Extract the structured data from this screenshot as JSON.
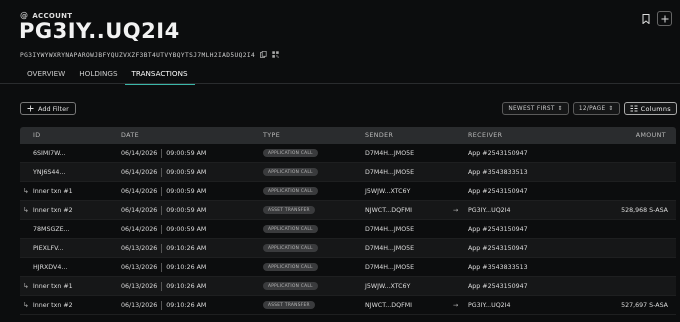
{
  "header": {
    "section_label": "ACCOUNT",
    "title": "PG3IY..UQ2I4",
    "address": "PG3IYWYWXRYNAPAROWJBFYQUZVXZF3BT4UTVYBQYTSJ7MLH2IAD5UQ2I4",
    "actions": [
      "bookmark-icon",
      "plus-icon"
    ]
  },
  "tabs": [
    {
      "label": "OVERVIEW",
      "active": false
    },
    {
      "label": "HOLDINGS",
      "active": false
    },
    {
      "label": "TRANSACTIONS",
      "active": true
    }
  ],
  "toolbar": {
    "add_filter_label": "Add Filter",
    "sort_label": "NEWEST FIRST",
    "page_size_label": "12/PAGE",
    "columns_label": "Columns"
  },
  "table": {
    "headers": {
      "id": "ID",
      "date": "DATE",
      "type": "TYPE",
      "sender": "SENDER",
      "receiver": "RECEIVER",
      "amount": "AMOUNT"
    },
    "rows": [
      {
        "id": "6SIMI7W...",
        "inner": false,
        "date": "06/14/2026",
        "time": "09:00:59 AM",
        "type": "APPLICATION CALL",
        "sender": "D7M4H...JMO5E",
        "arrow": "",
        "receiver": "App #2543150947",
        "amount": ""
      },
      {
        "id": "YNJ6S44...",
        "inner": false,
        "date": "06/14/2026",
        "time": "09:00:59 AM",
        "type": "APPLICATION CALL",
        "sender": "D7M4H...JMO5E",
        "arrow": "",
        "receiver": "App #3543833513",
        "amount": ""
      },
      {
        "id": "Inner txn #1",
        "inner": true,
        "date": "06/14/2026",
        "time": "09:00:59 AM",
        "type": "APPLICATION CALL",
        "sender": "J5WJW...XTC6Y",
        "arrow": "",
        "receiver": "App #2543150947",
        "amount": ""
      },
      {
        "id": "Inner txn #2",
        "inner": true,
        "date": "06/14/2026",
        "time": "09:00:59 AM",
        "type": "ASSET TRANSFER",
        "sender": "NJWCT...DQFMI",
        "arrow": "→",
        "receiver": "PG3IY...UQ2I4",
        "amount": "528,968 S-ASA"
      },
      {
        "id": "78MSGZE...",
        "inner": false,
        "date": "06/14/2026",
        "time": "09:00:59 AM",
        "type": "APPLICATION CALL",
        "sender": "D7M4H...JMO5E",
        "arrow": "",
        "receiver": "App #2543150947",
        "amount": ""
      },
      {
        "id": "PIEXLFV...",
        "inner": false,
        "date": "06/13/2026",
        "time": "09:10:26 AM",
        "type": "APPLICATION CALL",
        "sender": "D7M4H...JMO5E",
        "arrow": "",
        "receiver": "App #2543150947",
        "amount": ""
      },
      {
        "id": "HJRXDV4...",
        "inner": false,
        "date": "06/13/2026",
        "time": "09:10:26 AM",
        "type": "APPLICATION CALL",
        "sender": "D7M4H...JMO5E",
        "arrow": "",
        "receiver": "App #3543833513",
        "amount": ""
      },
      {
        "id": "Inner txn #1",
        "inner": true,
        "date": "06/13/2026",
        "time": "09:10:26 AM",
        "type": "APPLICATION CALL",
        "sender": "J5WJW...XTC6Y",
        "arrow": "",
        "receiver": "App #2543150947",
        "amount": ""
      },
      {
        "id": "Inner txn #2",
        "inner": true,
        "date": "06/13/2026",
        "time": "09:10:26 AM",
        "type": "ASSET TRANSFER",
        "sender": "NJWCT...DQFMI",
        "arrow": "→",
        "receiver": "PG3IY...UQ2I4",
        "amount": "527,697 S-ASA"
      }
    ]
  },
  "colors": {
    "background": "#0c0d0e",
    "accent": "#3bb6a8",
    "header_row": "#2a2c2e"
  }
}
